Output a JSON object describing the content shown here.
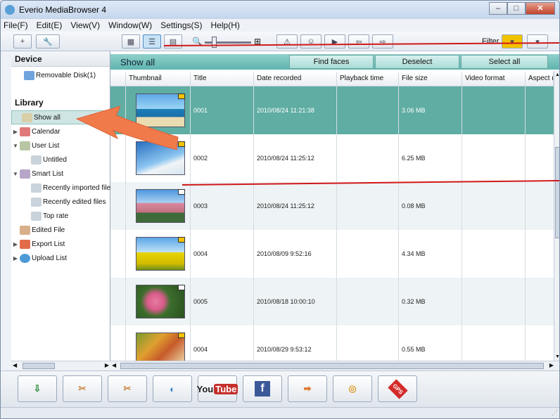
{
  "app": {
    "title": "Everio MediaBrowser 4"
  },
  "menu": [
    "File(F)",
    "Edit(E)",
    "View(V)",
    "Window(W)",
    "Settings(S)",
    "Help(H)"
  ],
  "toolbar": {
    "add": "+",
    "filter_label": "Filter"
  },
  "sidebar": {
    "device_header": "Device",
    "device_items": [
      "Removable Disk(1)"
    ],
    "library_header": "Library",
    "items": [
      "Show all",
      "Calendar",
      "User List",
      "Untitled",
      "Smart List",
      "Recently imported files",
      "Recently edited files",
      "Top rate",
      "Edited File",
      "Export List",
      "Upload List"
    ]
  },
  "main": {
    "show_label": "Show all",
    "find_faces": "Find faces",
    "deselect": "Deselect",
    "select_all": "Select all",
    "columns": [
      "Thumbnail",
      "Title",
      "Date recorded",
      "Playback time",
      "File size",
      "Video format",
      "Aspect r"
    ]
  },
  "rows": [
    {
      "title": "0001",
      "date": "2010/08/24 11:21:38",
      "size": "3.06 MB"
    },
    {
      "title": "0002",
      "date": "2010/08/24 11:25:12",
      "size": "6.25 MB"
    },
    {
      "title": "0003",
      "date": "2010/08/24 11:25:12",
      "size": "0.08 MB"
    },
    {
      "title": "0004",
      "date": "2010/08/09 9:52:16",
      "size": "4.34 MB"
    },
    {
      "title": "0005",
      "date": "2010/08/18 10:00:10",
      "size": "0.32 MB"
    },
    {
      "title": "0004",
      "date": "2010/08/29 9:53:12",
      "size": "0.55 MB"
    }
  ],
  "bottom": {
    "youtube_you": "You",
    "youtube_tube": "Tube",
    "facebook": "f",
    "gps": "GPS"
  },
  "colors": {
    "accent": "#5fada3",
    "arrow": "#f07a4a",
    "annot_line": "#d01818"
  }
}
